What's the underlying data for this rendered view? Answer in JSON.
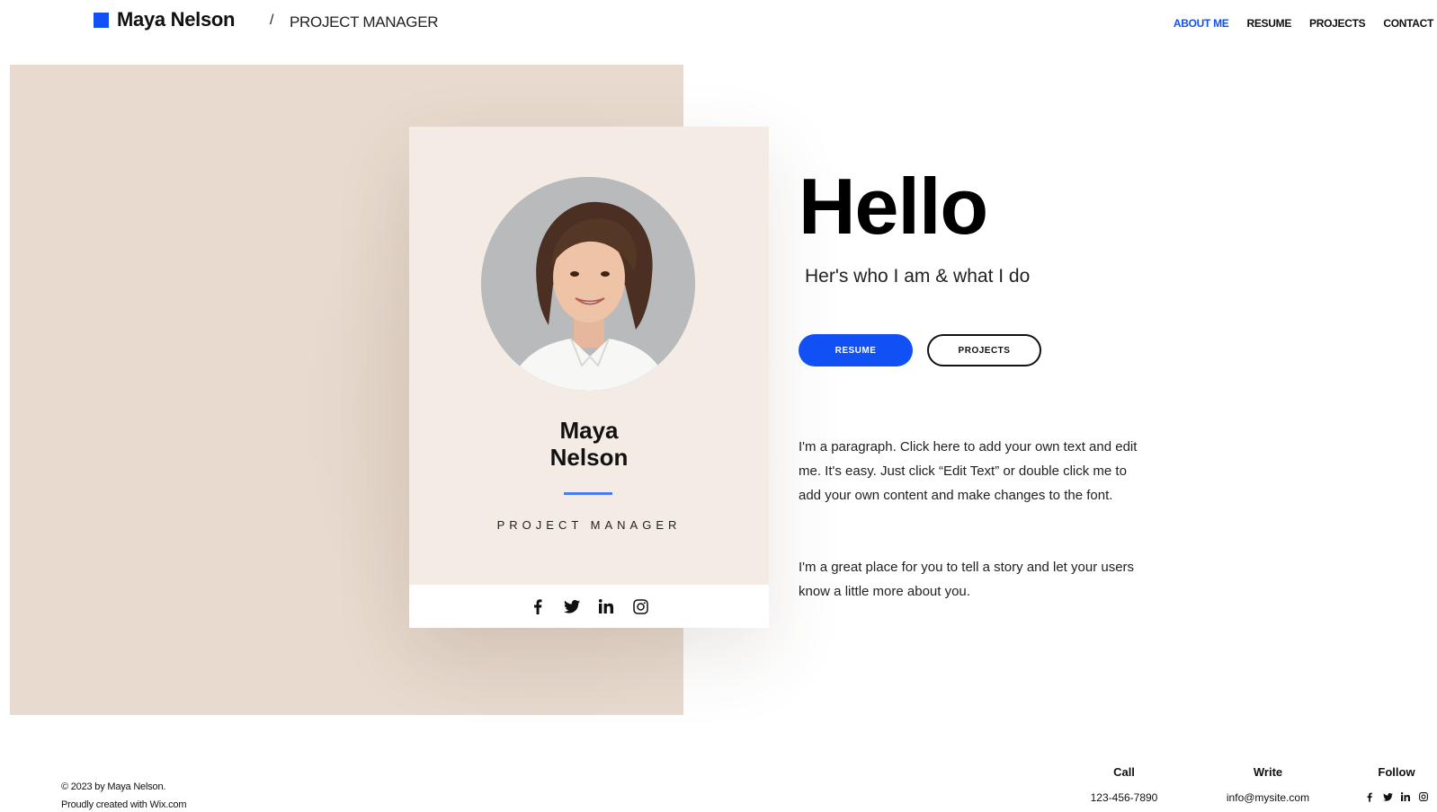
{
  "header": {
    "brand_name": "Maya Nelson",
    "separator": "/",
    "brand_role": "PROJECT MANAGER",
    "nav": [
      {
        "label": "ABOUT ME",
        "active": true
      },
      {
        "label": "RESUME",
        "active": false
      },
      {
        "label": "PROJECTS",
        "active": false
      },
      {
        "label": "CONTACT",
        "active": false
      }
    ]
  },
  "card": {
    "first_name": "Maya",
    "last_name": "Nelson",
    "role": "PROJECT MANAGER",
    "social_icons": [
      "facebook-icon",
      "twitter-icon",
      "linkedin-icon",
      "instagram-icon"
    ]
  },
  "hero": {
    "title": "Hello",
    "tagline": "Her's who I am & what I do",
    "resume_button": "RESUME",
    "projects_button": "PROJECTS",
    "paragraph1": "I'm a paragraph. Click here to add your own text and edit me. It's easy. Just click “Edit Text” or double click me to add your own content and make changes to the font.",
    "paragraph2": "I'm a great place for you to tell a story and let your users know a little more about you."
  },
  "footer": {
    "copyright": "© 2023 by Maya Nelson.",
    "credit": "Proudly created with Wix.com",
    "call_heading": "Call",
    "call_value": "123-456-7890",
    "write_heading": "Write",
    "write_value": "info@mysite.com",
    "follow_heading": "Follow"
  },
  "colors": {
    "accent": "#1150f5",
    "beige_block": "#e8dace",
    "card_bg": "#f3ebe4"
  }
}
